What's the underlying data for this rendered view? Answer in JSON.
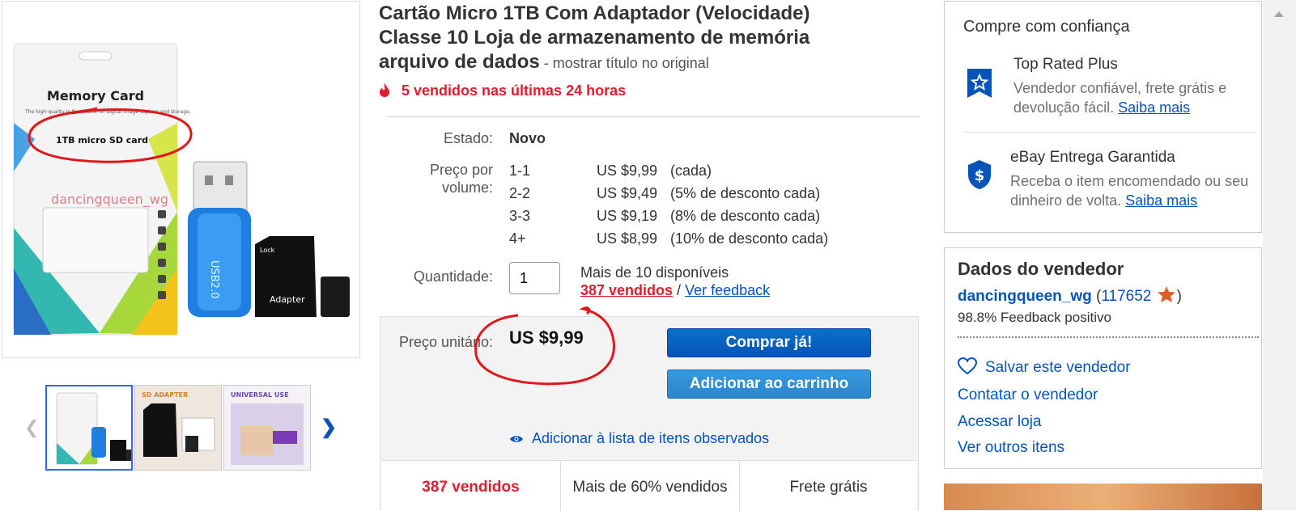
{
  "title": {
    "main": "Cartão Micro 1TB Com Adaptador (Velocidade) Classe 10 Loja de armazenamento de memória arquivo de dados",
    "separator": " - ",
    "original_link": "mostrar título no original"
  },
  "hot_text": "5 vendidos nas últimas 24 horas",
  "condition": {
    "label": "Estado:",
    "value": "Novo"
  },
  "volume_pricing": {
    "label_line1": "Preço por",
    "label_line2": "volume:",
    "rows": [
      {
        "qty": "1-1",
        "price": "US $9,99",
        "note": "(cada)"
      },
      {
        "qty": "2-2",
        "price": "US $9,49",
        "note": "(5% de desconto cada)"
      },
      {
        "qty": "3-3",
        "price": "US $9,19",
        "note": "(8% de desconto cada)"
      },
      {
        "qty": "4+",
        "price": "US $8,99",
        "note": "(10% de desconto cada)"
      }
    ]
  },
  "quantity": {
    "label": "Quantidade:",
    "value": "1",
    "available": "Mais de 10 disponíveis",
    "sold_link": "387 vendidos",
    "sep": " / ",
    "feedback_link": "Ver feedback"
  },
  "price_box": {
    "label": "Preço unitário:",
    "price": "US $9,99",
    "buy_now": "Comprar já!",
    "add_cart": "Adicionar ao carrinho",
    "watch": "Adicionar à lista de itens observados"
  },
  "stats": [
    {
      "text": "387 vendidos",
      "color": "#dd1e31"
    },
    {
      "text": "Mais de 60% vendidos",
      "color": "#333333"
    },
    {
      "text": "Frete grátis",
      "color": "#333333"
    }
  ],
  "image_text": {
    "memory_card": "Memory Card",
    "small": "The high-quality is the choice for digital image capture and storage.",
    "sd_label": "1TB micro SD card",
    "watermark": "dancingqueen_wg",
    "usb": "USB2.0",
    "lock": "Lock",
    "adapter": "Adapter",
    "thumb2": "SD ADAPTER",
    "thumb3": "UNIVERSAL USE"
  },
  "trust": {
    "title": "Compre com confiança",
    "top_rated_title": "Top Rated Plus",
    "top_rated_text": "Vendedor confiável, frete grátis e devolução fácil.",
    "top_rated_link": "Saiba mais",
    "guarantee_title": "eBay Entrega Garantida",
    "guarantee_text": "Receba o item encomendado ou seu dinheiro de volta.",
    "guarantee_link": "Saiba mais"
  },
  "seller": {
    "heading": "Dados do vendedor",
    "name": "dancingqueen_wg",
    "open_paren": " (",
    "score": "117652",
    "close_paren": ")",
    "feedback": "98.8% Feedback positivo",
    "save": "Salvar este vendedor",
    "contact": "Contatar o vendedor",
    "store": "Acessar loja",
    "other": "Ver outros itens"
  },
  "colors": {
    "ebay_blue": "#0654ba",
    "hot_red": "#dd1e31",
    "annotation_red": "#e0181c"
  }
}
